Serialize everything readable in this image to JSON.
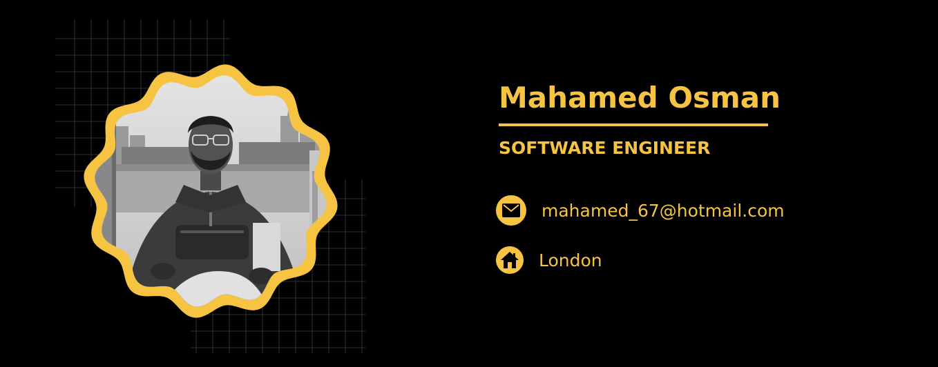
{
  "profile": {
    "name": "Mahamed Osman",
    "title": "SOFTWARE ENGINEER",
    "photo_alt": "Black and white portrait photo",
    "accent_color": "#f6c343",
    "background_color": "#000000"
  },
  "contacts": [
    {
      "icon": "envelope-icon",
      "value": "mahamed_67@hotmail.com"
    },
    {
      "icon": "home-icon",
      "value": "London"
    }
  ]
}
